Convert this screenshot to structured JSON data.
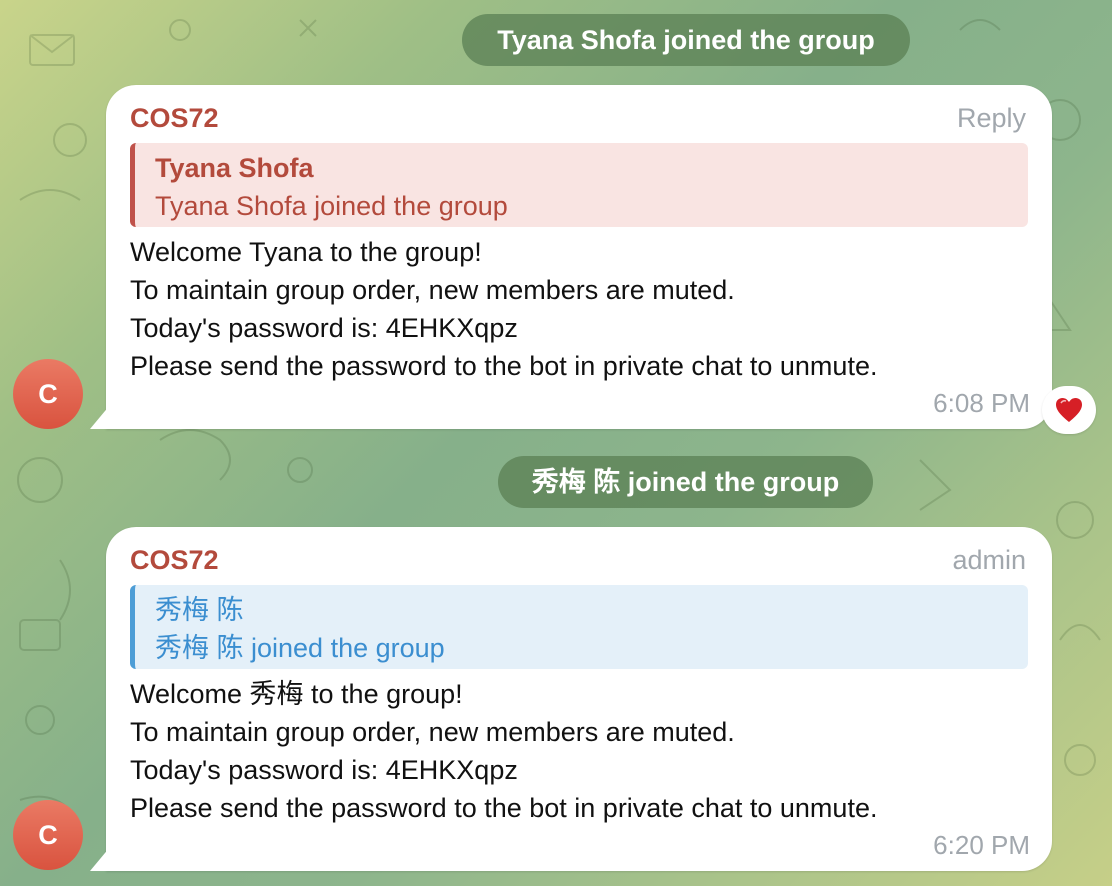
{
  "service_messages": [
    {
      "text": "Tyana Shofa joined the group"
    },
    {
      "text": "秀梅 陈 joined the group"
    }
  ],
  "messages": [
    {
      "sender": "COS72",
      "corner_label": "Reply",
      "quote": {
        "name": "Tyana Shofa",
        "text": "Tyana Shofa joined the group"
      },
      "lines": [
        "Welcome Tyana to the group!",
        "To maintain group order, new members are muted.",
        "Today's password is: 4EHKXqpz",
        "Please send the password to the bot in private chat to unmute."
      ],
      "time": "6:08 PM",
      "reaction": "heart-icon",
      "avatar_letter": "C"
    },
    {
      "sender": "COS72",
      "corner_label": "admin",
      "quote": {
        "name": "秀梅 陈",
        "text": "秀梅 陈 joined the group"
      },
      "lines": [
        "Welcome 秀梅 to the group!",
        "To maintain group order, new members are muted.",
        "Today's password is: 4EHKXqpz",
        "Please send the password to the bot in private chat to unmute."
      ],
      "time": "6:20 PM",
      "avatar_letter": "C"
    }
  ],
  "colors": {
    "sender": "#b34a3c",
    "quote_red_accent": "#c0524a",
    "quote_blue_accent": "#4d9dd6",
    "avatar": "#e0604a",
    "meta_text": "#a1a7ad"
  }
}
